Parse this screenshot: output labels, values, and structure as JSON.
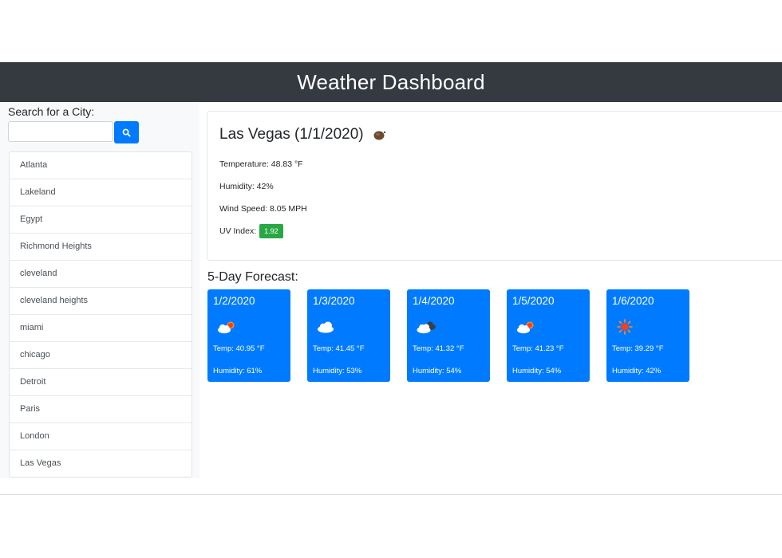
{
  "header": {
    "title": "Weather Dashboard"
  },
  "search": {
    "label": "Search for a City:",
    "value": "",
    "placeholder": "",
    "button_icon": "search-icon"
  },
  "cities": [
    "Atlanta",
    "Lakeland",
    "Egypt",
    "Richmond Heights",
    "cleveland",
    "cleveland heights",
    "miami",
    "chicago",
    "Detroit",
    "Paris",
    "London",
    "Las Vegas"
  ],
  "current": {
    "title": "Las Vegas (1/1/2020)",
    "icon": "brown-orb-icon",
    "temperature": "Temperature: 48.83 °F",
    "humidity": "Humidity: 42%",
    "wind": "Wind Speed: 8.05 MPH",
    "uv_label": "UV Index:",
    "uv_value": "1.92"
  },
  "forecast": {
    "title": "5-Day Forecast:",
    "days": [
      {
        "date": "1/2/2020",
        "icon": "cloud-sun-icon",
        "temp": "Temp: 40.95 °F",
        "humidity": "Humidity: 61%"
      },
      {
        "date": "1/3/2020",
        "icon": "cloud-icon",
        "temp": "Temp: 41.45 °F",
        "humidity": "Humidity: 53%"
      },
      {
        "date": "1/4/2020",
        "icon": "broken-clouds-icon",
        "temp": "Temp: 41.32 °F",
        "humidity": "Humidity: 54%"
      },
      {
        "date": "1/5/2020",
        "icon": "cloud-sun-icon",
        "temp": "Temp: 41.23 °F",
        "humidity": "Humidity: 54%"
      },
      {
        "date": "1/6/2020",
        "icon": "sun-icon",
        "temp": "Temp: 39.29 °F",
        "humidity": "Humidity: 42%"
      }
    ]
  },
  "colors": {
    "header_bg": "#343a40",
    "primary": "#007bff",
    "uv_badge": "#28a745",
    "sidebar_bg": "#f8f9fa"
  }
}
